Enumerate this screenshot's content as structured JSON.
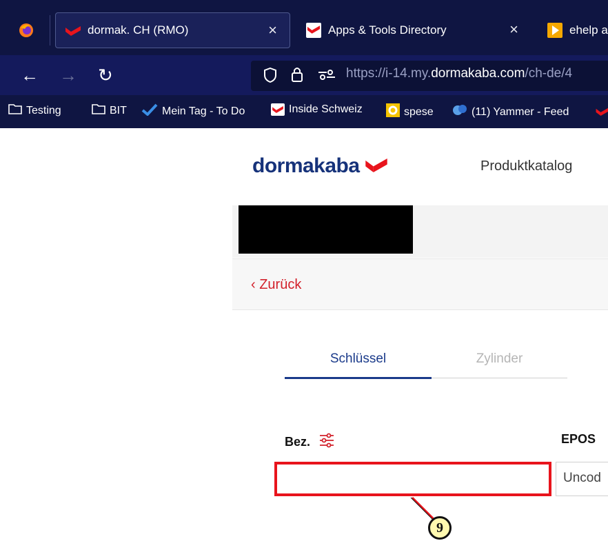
{
  "browser": {
    "tabs": [
      {
        "label": "dormak. CH (RMO)",
        "close": "×"
      },
      {
        "label": "Apps & Tools Directory",
        "close": "×"
      },
      {
        "label": "ehelp a"
      }
    ],
    "url": {
      "prefix": "https://i-14.my.",
      "domain": "dormakaba.com",
      "suffix": "/ch-de/4"
    },
    "bookmarks": [
      "Testing",
      "BIT",
      "Mein Tag - To Do",
      "Inside Schweiz",
      "spese",
      "(11) Yammer - Feed"
    ]
  },
  "page": {
    "logo": "dormakaba",
    "nav_link": "Produktkatalog",
    "back_link": "‹ Zurück",
    "tabs": [
      "Schlüssel",
      "Zylinder"
    ],
    "columns": {
      "bez": "Bez.",
      "epos": "EPOS"
    },
    "epos_value": "Uncod"
  },
  "annotation": {
    "number": "9"
  },
  "colors": {
    "brand_red": "#d2202a",
    "brand_blue": "#16327a",
    "highlight": "#e8141c"
  }
}
